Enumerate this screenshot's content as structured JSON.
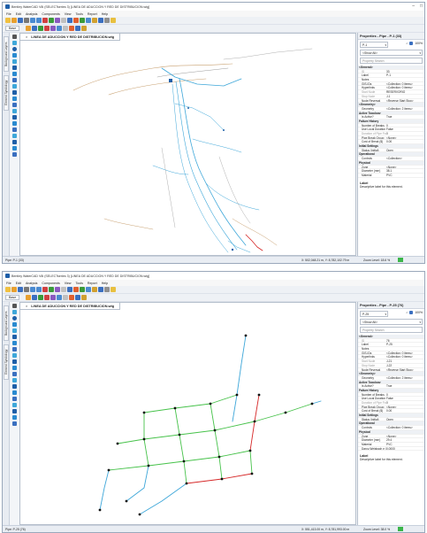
{
  "menus": [
    "File",
    "Edit",
    "Analysis",
    "Components",
    "View",
    "Tools",
    "Report",
    "Help"
  ],
  "toolbar": {
    "base_label": "Base"
  },
  "left_tabs": [
    "Background Layers",
    "Element Symbology"
  ],
  "colors": {
    "pipe_blue": "#3ea7d9",
    "pipe_green": "#46c24a",
    "pipe_red": "#d62828",
    "terrain_tan": "#c8a070",
    "contour_gray": "#9a9a9a",
    "title_blue": "#1f5fa8"
  },
  "screens": [
    {
      "title": "Bentley WaterCAD V8i (SELECTseries 3) [LINEA DE ADUCCION Y RED DE DISTRIBUCION.wtg]",
      "drawing_tab": "LINEA DE ADUCCION Y RED DE DISTRIBUCION.wtg",
      "properties": {
        "title": "Properties - Pipe - P-1 (33)",
        "element": "P-1",
        "zoom": "100%",
        "filter": "<Show All>",
        "search": "Property Search",
        "rows": [
          {
            "g": 1,
            "k": "<General>"
          },
          {
            "k": "ID",
            "v": "33",
            "dim": 1
          },
          {
            "k": "Label",
            "v": "P-1"
          },
          {
            "k": "Notes",
            "v": ""
          },
          {
            "k": "GIS-IDs",
            "v": "<Collection: 0 items>"
          },
          {
            "k": "Hyperlinks",
            "v": "<Collection: 0 items>"
          },
          {
            "k": "Start Node",
            "v": "RESERVORIO",
            "dim": 1
          },
          {
            "k": "Stop Node",
            "v": "J-1",
            "dim": 1
          },
          {
            "k": "Node Reversal",
            "v": "<Reverse Start Stop>"
          },
          {
            "g": 1,
            "k": "<Geometry>"
          },
          {
            "k": "Geometry",
            "v": "<Collection: 2 items>"
          },
          {
            "g": 1,
            "k": "Active Topology"
          },
          {
            "k": "Is Active?",
            "v": "True"
          },
          {
            "g": 1,
            "k": "Failure History"
          },
          {
            "k": "Number of Breaks",
            "v": "0"
          },
          {
            "k": "Use Local Duration",
            "v": "False"
          },
          {
            "k": "Duration of Pipe Fa",
            "v": "0",
            "dim": 1
          },
          {
            "k": "Pipe Break Group",
            "v": "<None>"
          },
          {
            "k": "Cost of Break ($)",
            "v": "0.00"
          },
          {
            "g": 1,
            "k": "Initial Settings"
          },
          {
            "k": "Status (Initial)",
            "v": "Open"
          },
          {
            "g": 1,
            "k": "Operational"
          },
          {
            "k": "Controls",
            "v": "<Collection>"
          },
          {
            "g": 1,
            "k": "Physical"
          },
          {
            "k": "Zone",
            "v": "<None>"
          },
          {
            "k": "Diameter (mm)",
            "v": "38.1"
          },
          {
            "k": "Material",
            "v": "PVC"
          }
        ],
        "label_title": "Label",
        "label_desc": "Descriptive label for this element."
      },
      "status": {
        "pipe": "Pipe: P-1 (33)",
        "coords": "X: 502,048.21 m, Y: 8,782,102.79 m",
        "zoom": "Zoom Level: 18.6 %"
      }
    },
    {
      "title": "Bentley WaterCAD V8i (SELECTseries 3) [LINEA DE ADUCCION Y RED DE DISTRIBUCION.wtg]",
      "drawing_tab": "LINEA DE ADUCCION Y RED DE DISTRIBUCION.wtg",
      "properties": {
        "title": "Properties - Pipe - P-25 (76)",
        "element": "P-25",
        "zoom": "100%",
        "filter": "<Show All>",
        "search": "Property Search",
        "rows": [
          {
            "g": 1,
            "k": "<General>"
          },
          {
            "k": "ID",
            "v": "76",
            "dim": 1
          },
          {
            "k": "Label",
            "v": "P-25"
          },
          {
            "k": "Notes",
            "v": ""
          },
          {
            "k": "GIS-IDs",
            "v": "<Collection: 0 items>"
          },
          {
            "k": "Hyperlinks",
            "v": "<Collection: 0 items>"
          },
          {
            "k": "Start Node",
            "v": "J-21",
            "dim": 1
          },
          {
            "k": "Stop Node",
            "v": "J-22",
            "dim": 1
          },
          {
            "k": "Node Reversal",
            "v": "<Reverse Start Stop>"
          },
          {
            "g": 1,
            "k": "<Geometry>"
          },
          {
            "k": "Geometry",
            "v": "<Collection: 2 items>"
          },
          {
            "g": 1,
            "k": "Active Topology"
          },
          {
            "k": "Is Active?",
            "v": "True"
          },
          {
            "g": 1,
            "k": "Failure History"
          },
          {
            "k": "Number of Breaks",
            "v": "0"
          },
          {
            "k": "Use Local Duration",
            "v": "False"
          },
          {
            "k": "Duration of Pipe Fa",
            "v": "0",
            "dim": 1
          },
          {
            "k": "Pipe Break Group",
            "v": "<None>"
          },
          {
            "k": "Cost of Break ($)",
            "v": "0.00"
          },
          {
            "g": 1,
            "k": "Initial Settings"
          },
          {
            "k": "Status (Initial)",
            "v": "Open"
          },
          {
            "g": 1,
            "k": "Operational"
          },
          {
            "k": "Controls",
            "v": "<Collection: 0 items>"
          },
          {
            "g": 1,
            "k": "Physical"
          },
          {
            "k": "Zone",
            "v": "<None>"
          },
          {
            "k": "Diameter (mm)",
            "v": "29.4"
          },
          {
            "k": "Material",
            "v": "PVC"
          },
          {
            "k": "Darcy-Weisbach e (",
            "v": "0.0000"
          }
        ],
        "label_title": "Label",
        "label_desc": "Descriptive label for this element."
      },
      "status": {
        "pipe": "Pipe: P-25 (76)",
        "coords": "X: 551,413.00 m, Y: 8,781,993.00 m",
        "zoom": "Zoom Level: 38.0 %"
      }
    }
  ]
}
